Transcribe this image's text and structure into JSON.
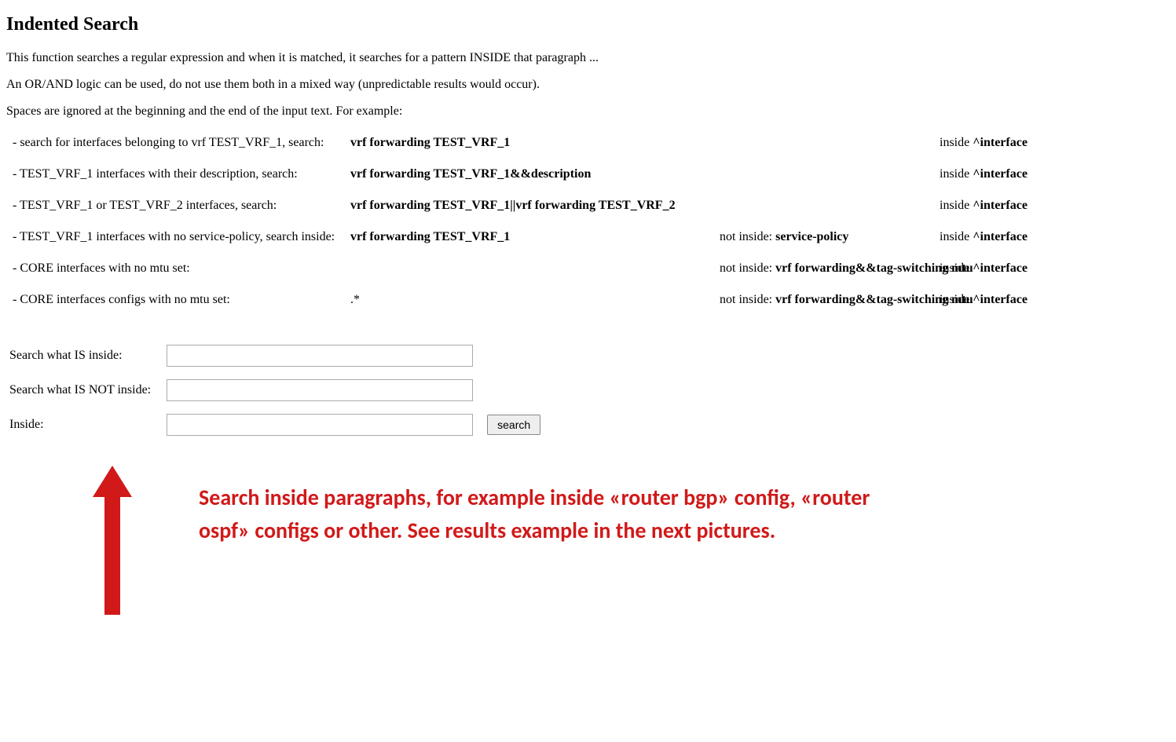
{
  "title": "Indented Search",
  "paragraphs": [
    "This function searches a regular expression and when it is matched, it searches for a pattern INSIDE that paragraph ...",
    "An OR/AND logic can be used, do not use them both in a mixed way (unpredictable results would occur).",
    "Spaces are ignored at the beginning and the end of the input text. For example:"
  ],
  "examples": [
    {
      "desc": "- search for interfaces belonging to vrf TEST_VRF_1, search:",
      "search": "vrf forwarding TEST_VRF_1",
      "not_label": "",
      "not_val": "",
      "inside_label": "inside",
      "inside_val": "^interface"
    },
    {
      "desc": "- TEST_VRF_1 interfaces with their description, search:",
      "search": "vrf forwarding TEST_VRF_1&&description",
      "not_label": "",
      "not_val": "",
      "inside_label": "inside",
      "inside_val": "^interface"
    },
    {
      "desc": "- TEST_VRF_1 or TEST_VRF_2 interfaces, search:",
      "search": "vrf forwarding TEST_VRF_1||vrf forwarding TEST_VRF_2",
      "not_label": "",
      "not_val": "",
      "inside_label": "inside",
      "inside_val": "^interface"
    },
    {
      "desc": "- TEST_VRF_1 interfaces with no service-policy, search inside:",
      "search": "vrf forwarding TEST_VRF_1",
      "not_label": "not inside:",
      "not_val": "service-policy",
      "inside_label": "inside",
      "inside_val": "^interface"
    },
    {
      "desc": "- CORE interfaces with no mtu set:",
      "search": "",
      "not_label": "not inside:",
      "not_val": "vrf forwarding&&tag-switching mtu",
      "inside_label": "inside",
      "inside_val": "^interface"
    },
    {
      "desc": "- CORE interfaces configs with no mtu set:",
      "search": ".*",
      "not_label": "not inside:",
      "not_val": "vrf forwarding&&tag-switching mtu",
      "inside_label": "inside",
      "inside_val": "^interface"
    }
  ],
  "form": {
    "is_inside_label": "Search what IS inside:",
    "is_not_inside_label": "Search what IS NOT inside:",
    "inside_label": "Inside:",
    "search_button": "search"
  },
  "annotation": "Search inside paragraphs, for example inside «router bgp» config, «router ospf» configs or other. See results example in the next pictures."
}
